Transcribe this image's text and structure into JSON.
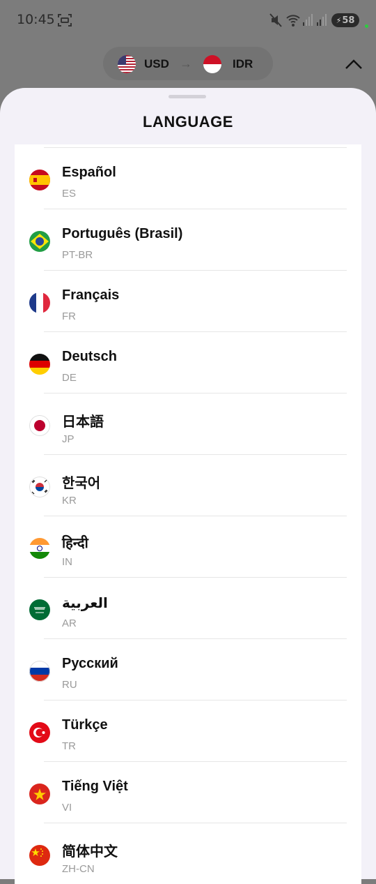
{
  "status_bar": {
    "time": "10:45",
    "battery": "58",
    "icons": [
      "screenshot-icon",
      "mute-icon",
      "wifi-icon",
      "signal-icon",
      "signal-icon",
      "battery-icon"
    ]
  },
  "converter": {
    "from": "USD",
    "to": "IDR",
    "arrow": "→"
  },
  "sheet": {
    "title": "LANGUAGE"
  },
  "languages": [
    {
      "name": "Español",
      "code": "ES",
      "flag": "spain-flag-icon"
    },
    {
      "name": "Português (Brasil)",
      "code": "PT-BR",
      "flag": "brazil-flag-icon"
    },
    {
      "name": "Français",
      "code": "FR",
      "flag": "france-flag-icon"
    },
    {
      "name": "Deutsch",
      "code": "DE",
      "flag": "germany-flag-icon"
    },
    {
      "name": "日本語",
      "code": "JP",
      "flag": "japan-flag-icon"
    },
    {
      "name": "한국어",
      "code": "KR",
      "flag": "korea-flag-icon"
    },
    {
      "name": "हिन्दी",
      "code": "IN",
      "flag": "india-flag-icon"
    },
    {
      "name": "العربية",
      "code": "AR",
      "flag": "saudi-flag-icon"
    },
    {
      "name": "Русский",
      "code": "RU",
      "flag": "russia-flag-icon"
    },
    {
      "name": "Türkçe",
      "code": "TR",
      "flag": "turkey-flag-icon"
    },
    {
      "name": "Tiếng Việt",
      "code": "VI",
      "flag": "vietnam-flag-icon"
    },
    {
      "name": "简体中文",
      "code": "ZH-CN",
      "flag": "china-flag-icon"
    }
  ]
}
